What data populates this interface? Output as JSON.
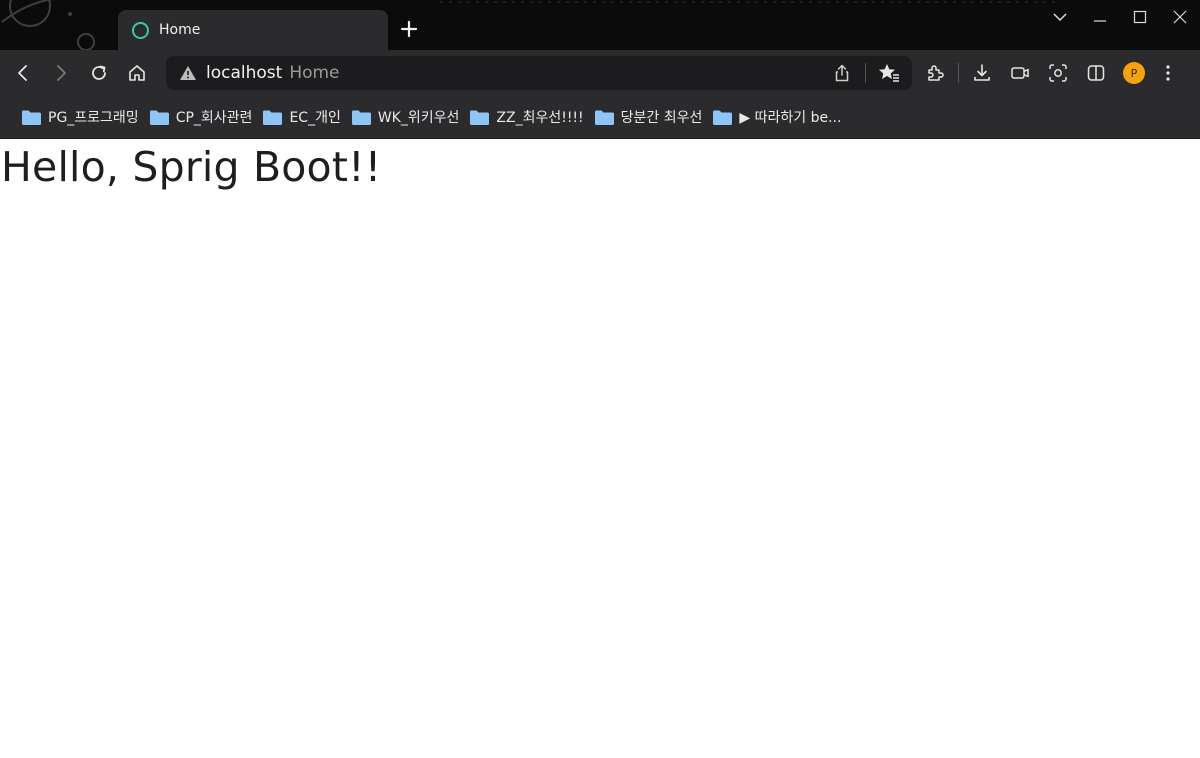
{
  "window": {
    "tabs": [
      {
        "title": "Home",
        "active": true
      }
    ]
  },
  "address_bar": {
    "host": "localhost",
    "page_title": "Home"
  },
  "bookmarks": [
    {
      "label": "PG_프로그래밍"
    },
    {
      "label": "CP_회사관련"
    },
    {
      "label": "EC_개인"
    },
    {
      "label": "WK_위키우선"
    },
    {
      "label": "ZZ_최우선!!!!"
    },
    {
      "label": "당분간 최우선"
    },
    {
      "label": "▶ 따라하기 be..."
    }
  ],
  "profile": {
    "initial": "P",
    "color": "#f5a20b"
  },
  "page": {
    "heading": "Hello, Sprig Boot!!"
  },
  "colors": {
    "chrome_dark": "#0b0b0c",
    "toolbar": "#2b2b2e",
    "omnibox": "#1c1c1e",
    "tab_favicon": "#3cc7a6",
    "folder": "#8ec5f5"
  },
  "icons": {
    "toolbar": [
      "back-icon",
      "forward-icon",
      "reload-icon",
      "home-icon"
    ],
    "omnibox": [
      "warning-icon",
      "share-icon",
      "favorites-star-icon"
    ],
    "right": [
      "extensions-icon",
      "download-icon",
      "screen-capture-icon",
      "screenshot-icon",
      "split-screen-icon",
      "menu-dots-icon"
    ]
  }
}
